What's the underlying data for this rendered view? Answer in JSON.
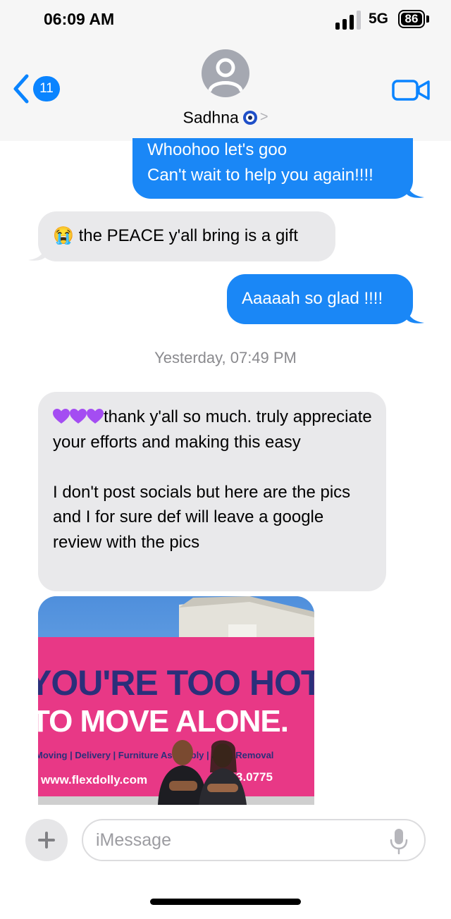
{
  "status_bar": {
    "time": "06:09 AM",
    "network": "5G",
    "battery": "86"
  },
  "header": {
    "back_count": "11",
    "contact_name": "Sadhna"
  },
  "messages": [
    {
      "direction": "sent",
      "text": "Whoohoo let's goo\nCan't wait to help you again!!!!"
    },
    {
      "direction": "received",
      "emoji": "😭",
      "text": "the PEACE y'all bring is a gift"
    },
    {
      "direction": "sent",
      "text": "Aaaaah so glad !!!!"
    }
  ],
  "timestamp": "Yesterday, 07:49 PM",
  "long_message": {
    "direction": "received",
    "text": "thank y'all so much. truly appreciate your efforts and making this easy\n\nI don't post socials but here are the pics and I for sure def will leave a google review with the pics"
  },
  "photo": {
    "line1": "YOU'RE TOO HOT",
    "line2": "TO MOVE ALONE.",
    "services": "Moving | Delivery | Furniture Assembly | Junk Removal",
    "website": "www.flexdolly.com",
    "phone": "733.0775"
  },
  "compose": {
    "placeholder": "iMessage"
  },
  "colors": {
    "sent_bubble": "#1a87f6",
    "received_bubble": "#e9e9eb",
    "accent": "#0a84ff",
    "banner_pink": "#e83886"
  }
}
